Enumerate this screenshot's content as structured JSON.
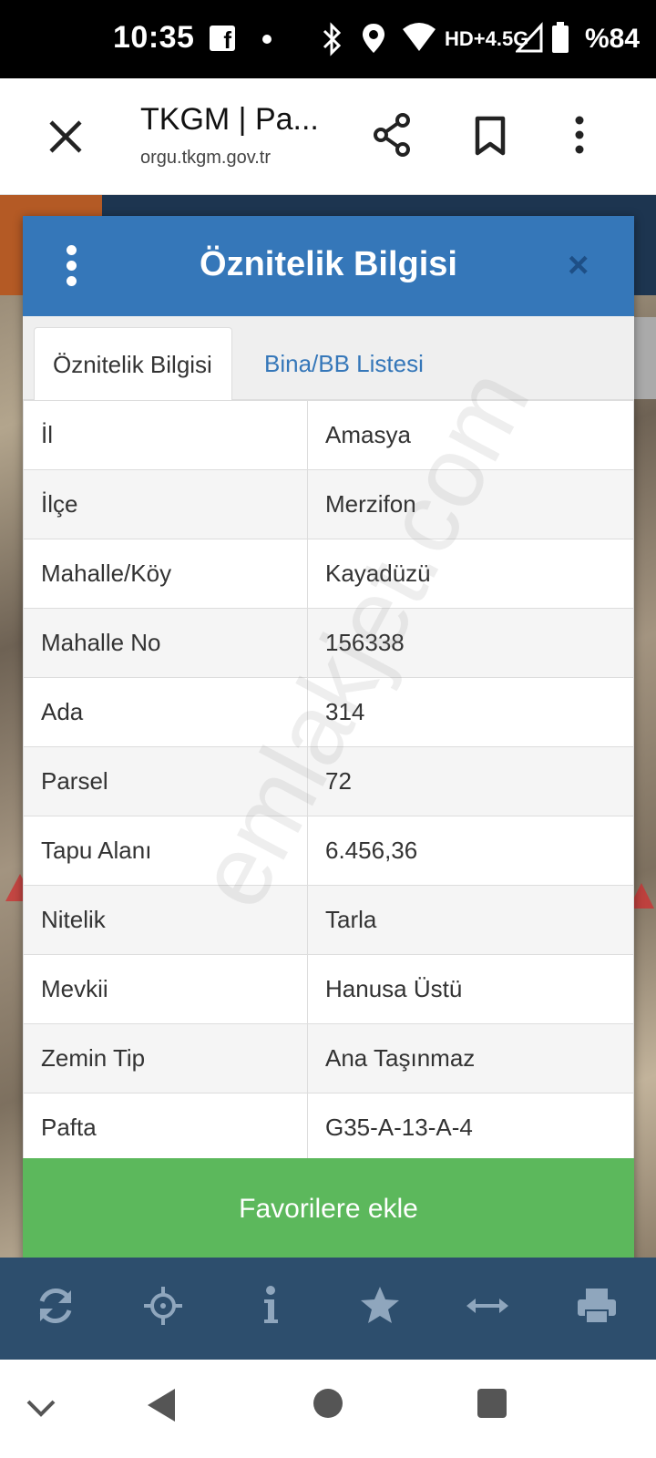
{
  "status_bar": {
    "time": "10:35",
    "network": "HD+4.5G",
    "battery": "%84",
    "icons": [
      "facebook-icon",
      "dot-icon",
      "bluetooth-icon",
      "location-icon",
      "wifi-icon",
      "signal-icon",
      "battery-icon"
    ]
  },
  "browser": {
    "title": "TKGM | Pa...",
    "url": "orgu.tkgm.gov.tr"
  },
  "dialog": {
    "title": "Öznitelik Bilgisi",
    "close_symbol": "×",
    "tabs": [
      {
        "label": "Öznitelik Bilgisi",
        "active": true
      },
      {
        "label": "Bina/BB Listesi",
        "active": false
      }
    ],
    "rows": [
      {
        "key": "İl",
        "value": "Amasya"
      },
      {
        "key": "İlçe",
        "value": "Merzifon"
      },
      {
        "key": "Mahalle/Köy",
        "value": "Kayadüzü"
      },
      {
        "key": "Mahalle No",
        "value": "156338"
      },
      {
        "key": "Ada",
        "value": "314"
      },
      {
        "key": "Parsel",
        "value": "72"
      },
      {
        "key": "Tapu Alanı",
        "value": "6.456,36"
      },
      {
        "key": "Nitelik",
        "value": "Tarla"
      },
      {
        "key": "Mevkii",
        "value": "Hanusa Üstü"
      },
      {
        "key": "Zemin Tip",
        "value": "Ana Taşınmaz"
      },
      {
        "key": "Pafta",
        "value": "G35-A-13-A-4"
      }
    ],
    "favorite_button": "Favorilere ekle"
  },
  "watermark": "emlakjet.com",
  "toolbar": {
    "tools": [
      "refresh-icon",
      "locate-icon",
      "info-icon",
      "favorite-star-icon",
      "measure-icon",
      "print-icon"
    ]
  },
  "colors": {
    "header_blue": "#3577b9",
    "button_green": "#5cb85c",
    "toolbar_navy": "#2d4e6d"
  }
}
